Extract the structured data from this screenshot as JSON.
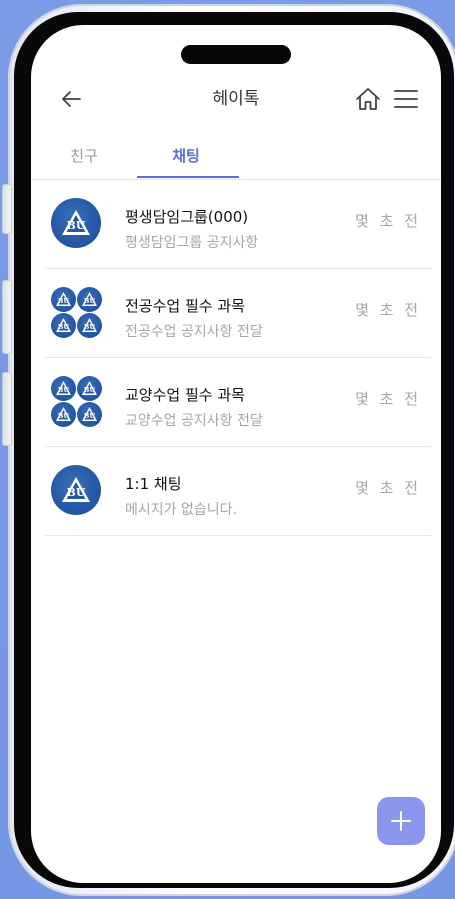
{
  "header": {
    "title": "헤이톡",
    "back_icon": "arrow-left-icon",
    "home_icon": "home-icon",
    "menu_icon": "hamburger-menu-icon"
  },
  "tabs": [
    {
      "label": "친구",
      "active": false
    },
    {
      "label": "채팅",
      "active": true
    }
  ],
  "chats": [
    {
      "name": "평생담임그룹(000)",
      "preview": "평생담임그룹 공지사항",
      "time": "몇 초 전",
      "avatar": "single"
    },
    {
      "name": "전공수업 필수 과목",
      "preview": "전공수업 공지사항 전달",
      "time": "몇 초 전",
      "avatar": "grid"
    },
    {
      "name": "교양수업 필수 과목",
      "preview": "교양수업 공지사항 전달",
      "time": "몇 초 전",
      "avatar": "grid"
    },
    {
      "name": "1:1 채팅",
      "preview": "메시지가 없습니다.",
      "time": "몇 초 전",
      "avatar": "single"
    }
  ],
  "logo_text": "BU",
  "fab": {
    "icon": "plus-icon"
  },
  "colors": {
    "accent": "#5c6ed8",
    "fab": "#8d96ef",
    "logo_blue": "#2458a6",
    "background": "#7b9be6"
  }
}
